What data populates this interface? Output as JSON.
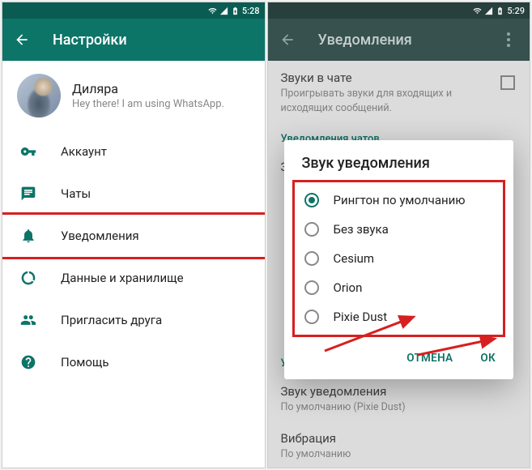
{
  "left": {
    "statusbar_time": "5:28",
    "appbar_title": "Настройки",
    "profile": {
      "name": "Диляра",
      "status": "Hey there! I am using WhatsApp."
    },
    "items": {
      "account": "Аккаунт",
      "chats": "Чаты",
      "notifications": "Уведомления",
      "data": "Данные и хранилище",
      "invite": "Пригласить друга",
      "help": "Помощь"
    }
  },
  "right": {
    "statusbar_time": "5:29",
    "appbar_title": "Уведомления",
    "bg": {
      "sounds_title": "Звуки в чате",
      "sounds_sub": "Проигрывать звуки для входящих и исходящих сообщений.",
      "section_chat": "Уведомления чатов",
      "sound_label": "Звук уведомления",
      "section_group": "Уведомления групп",
      "sound_label2": "Звук уведомления",
      "sound_sub2": "По умолчанию (Pixie Dust)",
      "vibration_label": "Вибрация",
      "vibration_sub": "По умолчанию"
    },
    "dialog": {
      "title": "Звук уведомления",
      "options": {
        "default": "Рингтон по умолчанию",
        "none": "Без звука",
        "cesium": "Cesium",
        "orion": "Orion",
        "pixie": "Pixie Dust"
      },
      "cancel": "ОТМЕНА",
      "ok": "ОК"
    }
  }
}
